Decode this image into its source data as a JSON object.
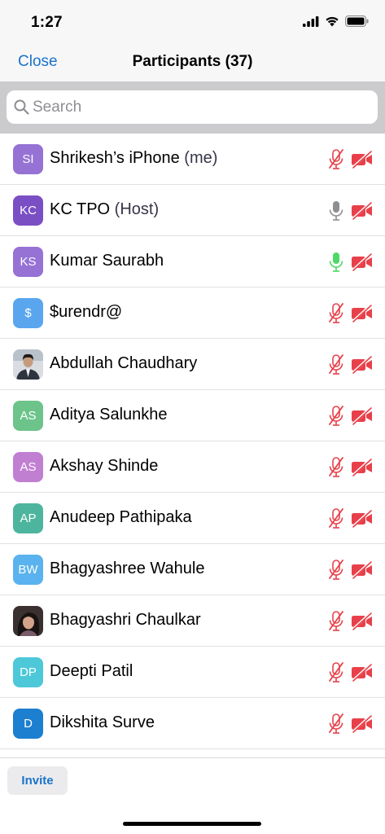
{
  "status_bar": {
    "time": "1:27"
  },
  "nav": {
    "close_label": "Close",
    "title": "Participants (37)"
  },
  "search": {
    "placeholder": "Search"
  },
  "colors": {
    "accent": "#1a73c9",
    "muted_red": "#e8404a",
    "mic_active": "#4cd964",
    "mic_unmuted": "#8e8e93"
  },
  "participants": [
    {
      "initials": "SI",
      "name": "Shrikesh’s iPhone",
      "tag": "(me)",
      "avatar_color": "#9572d4",
      "photo": false,
      "mic": "muted"
    },
    {
      "initials": "KC",
      "name": "KC TPO",
      "tag": "(Host)",
      "avatar_color": "#7b4fc4",
      "photo": false,
      "mic": "unmuted"
    },
    {
      "initials": "KS",
      "name": "Kumar Saurabh",
      "tag": "",
      "avatar_color": "#9572d4",
      "photo": false,
      "mic": "speaking"
    },
    {
      "initials": "$",
      "name": "$urendr@",
      "tag": "",
      "avatar_color": "#5aa6ee",
      "photo": false,
      "mic": "muted"
    },
    {
      "initials": "",
      "name": "Abdullah Chaudhary",
      "tag": "",
      "avatar_color": "#cfd4da",
      "photo": true,
      "mic": "muted"
    },
    {
      "initials": "AS",
      "name": "Aditya Salunkhe",
      "tag": "",
      "avatar_color": "#6cc48a",
      "photo": false,
      "mic": "muted"
    },
    {
      "initials": "AS",
      "name": "Akshay Shinde",
      "tag": "",
      "avatar_color": "#c17fd2",
      "photo": false,
      "mic": "muted"
    },
    {
      "initials": "AP",
      "name": "Anudeep Pathipaka",
      "tag": "",
      "avatar_color": "#4db59e",
      "photo": false,
      "mic": "muted"
    },
    {
      "initials": "BW",
      "name": "Bhagyashree Wahule",
      "tag": "",
      "avatar_color": "#5ab3ee",
      "photo": false,
      "mic": "muted"
    },
    {
      "initials": "",
      "name": "Bhagyashri Chaulkar",
      "tag": "",
      "avatar_color": "#3a3030",
      "photo": true,
      "mic": "muted"
    },
    {
      "initials": "DP",
      "name": "Deepti Patil",
      "tag": "",
      "avatar_color": "#4dc8d8",
      "photo": false,
      "mic": "muted"
    },
    {
      "initials": "D",
      "name": "Dikshita Surve",
      "tag": "",
      "avatar_color": "#1c7fd0",
      "photo": false,
      "mic": "muted"
    }
  ],
  "footer": {
    "invite_label": "Invite"
  }
}
